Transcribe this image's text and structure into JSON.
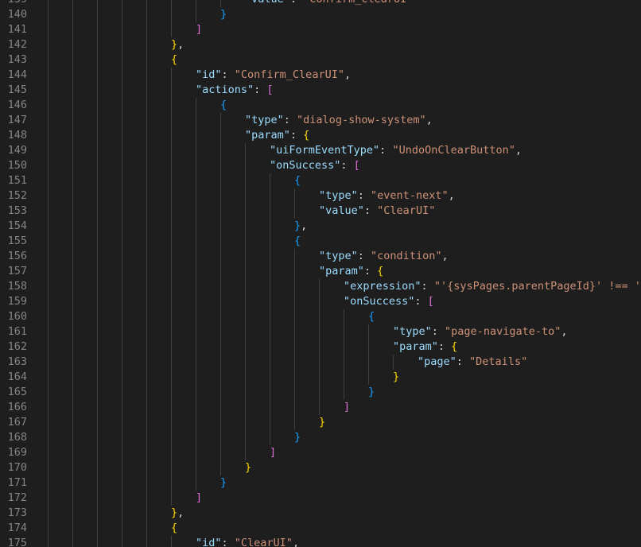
{
  "editor": {
    "language": "json",
    "lines": [
      {
        "n": "139",
        "indent": 8,
        "toks": [
          {
            "t": "\"value\"",
            "c": "k"
          },
          {
            "t": ": ",
            "c": "p"
          },
          {
            "t": "\"Confirm_ClearUI\"",
            "c": "s"
          }
        ]
      },
      {
        "n": "140",
        "indent": 7,
        "toks": [
          {
            "t": "}",
            "c": "b3"
          }
        ]
      },
      {
        "n": "141",
        "indent": 6,
        "toks": [
          {
            "t": "]",
            "c": "b2"
          }
        ]
      },
      {
        "n": "142",
        "indent": 5,
        "toks": [
          {
            "t": "}",
            "c": "b1"
          },
          {
            "t": ",",
            "c": "p"
          }
        ]
      },
      {
        "n": "143",
        "indent": 5,
        "toks": [
          {
            "t": "{",
            "c": "b1"
          }
        ]
      },
      {
        "n": "144",
        "indent": 6,
        "toks": [
          {
            "t": "\"id\"",
            "c": "k"
          },
          {
            "t": ": ",
            "c": "p"
          },
          {
            "t": "\"Confirm_ClearUI\"",
            "c": "s"
          },
          {
            "t": ",",
            "c": "p"
          }
        ]
      },
      {
        "n": "145",
        "indent": 6,
        "toks": [
          {
            "t": "\"actions\"",
            "c": "k"
          },
          {
            "t": ": ",
            "c": "p"
          },
          {
            "t": "[",
            "c": "b2"
          }
        ]
      },
      {
        "n": "146",
        "indent": 7,
        "toks": [
          {
            "t": "{",
            "c": "b3"
          }
        ]
      },
      {
        "n": "147",
        "indent": 8,
        "toks": [
          {
            "t": "\"type\"",
            "c": "k"
          },
          {
            "t": ": ",
            "c": "p"
          },
          {
            "t": "\"dialog-show-system\"",
            "c": "s"
          },
          {
            "t": ",",
            "c": "p"
          }
        ]
      },
      {
        "n": "148",
        "indent": 8,
        "toks": [
          {
            "t": "\"param\"",
            "c": "k"
          },
          {
            "t": ": ",
            "c": "p"
          },
          {
            "t": "{",
            "c": "b1"
          }
        ]
      },
      {
        "n": "149",
        "indent": 9,
        "toks": [
          {
            "t": "\"uiFormEventType\"",
            "c": "k"
          },
          {
            "t": ": ",
            "c": "p"
          },
          {
            "t": "\"UndoOnClearButton\"",
            "c": "s"
          },
          {
            "t": ",",
            "c": "p"
          }
        ]
      },
      {
        "n": "150",
        "indent": 9,
        "toks": [
          {
            "t": "\"onSuccess\"",
            "c": "k"
          },
          {
            "t": ": ",
            "c": "p"
          },
          {
            "t": "[",
            "c": "b2"
          }
        ]
      },
      {
        "n": "151",
        "indent": 10,
        "toks": [
          {
            "t": "{",
            "c": "b3"
          }
        ]
      },
      {
        "n": "152",
        "indent": 11,
        "toks": [
          {
            "t": "\"type\"",
            "c": "k"
          },
          {
            "t": ": ",
            "c": "p"
          },
          {
            "t": "\"event-next\"",
            "c": "s"
          },
          {
            "t": ",",
            "c": "p"
          }
        ]
      },
      {
        "n": "153",
        "indent": 11,
        "toks": [
          {
            "t": "\"value\"",
            "c": "k"
          },
          {
            "t": ": ",
            "c": "p"
          },
          {
            "t": "\"ClearUI\"",
            "c": "s"
          }
        ]
      },
      {
        "n": "154",
        "indent": 10,
        "toks": [
          {
            "t": "}",
            "c": "b3"
          },
          {
            "t": ",",
            "c": "p"
          }
        ]
      },
      {
        "n": "155",
        "indent": 10,
        "toks": [
          {
            "t": "{",
            "c": "b3"
          }
        ]
      },
      {
        "n": "156",
        "indent": 11,
        "toks": [
          {
            "t": "\"type\"",
            "c": "k"
          },
          {
            "t": ": ",
            "c": "p"
          },
          {
            "t": "\"condition\"",
            "c": "s"
          },
          {
            "t": ",",
            "c": "p"
          }
        ]
      },
      {
        "n": "157",
        "indent": 11,
        "toks": [
          {
            "t": "\"param\"",
            "c": "k"
          },
          {
            "t": ": ",
            "c": "p"
          },
          {
            "t": "{",
            "c": "b1"
          }
        ]
      },
      {
        "n": "158",
        "indent": 12,
        "toks": [
          {
            "t": "\"expression\"",
            "c": "k"
          },
          {
            "t": ": ",
            "c": "p"
          },
          {
            "t": "\"'{sysPages.parentPageId}' !== ''\"",
            "c": "s"
          },
          {
            "t": ",",
            "c": "p"
          }
        ]
      },
      {
        "n": "159",
        "indent": 12,
        "toks": [
          {
            "t": "\"onSuccess\"",
            "c": "k"
          },
          {
            "t": ": ",
            "c": "p"
          },
          {
            "t": "[",
            "c": "b2"
          }
        ]
      },
      {
        "n": "160",
        "indent": 13,
        "toks": [
          {
            "t": "{",
            "c": "b3"
          }
        ]
      },
      {
        "n": "161",
        "indent": 14,
        "toks": [
          {
            "t": "\"type\"",
            "c": "k"
          },
          {
            "t": ": ",
            "c": "p"
          },
          {
            "t": "\"page-navigate-to\"",
            "c": "s"
          },
          {
            "t": ",",
            "c": "p"
          }
        ]
      },
      {
        "n": "162",
        "indent": 14,
        "toks": [
          {
            "t": "\"param\"",
            "c": "k"
          },
          {
            "t": ": ",
            "c": "p"
          },
          {
            "t": "{",
            "c": "b1"
          }
        ]
      },
      {
        "n": "163",
        "indent": 15,
        "toks": [
          {
            "t": "\"page\"",
            "c": "k"
          },
          {
            "t": ": ",
            "c": "p"
          },
          {
            "t": "\"Details\"",
            "c": "s"
          }
        ]
      },
      {
        "n": "164",
        "indent": 14,
        "toks": [
          {
            "t": "}",
            "c": "b1"
          }
        ]
      },
      {
        "n": "165",
        "indent": 13,
        "toks": [
          {
            "t": "}",
            "c": "b3"
          }
        ]
      },
      {
        "n": "166",
        "indent": 12,
        "toks": [
          {
            "t": "]",
            "c": "b2"
          }
        ]
      },
      {
        "n": "167",
        "indent": 11,
        "toks": [
          {
            "t": "}",
            "c": "b1"
          }
        ]
      },
      {
        "n": "168",
        "indent": 10,
        "toks": [
          {
            "t": "}",
            "c": "b3"
          }
        ]
      },
      {
        "n": "169",
        "indent": 9,
        "toks": [
          {
            "t": "]",
            "c": "b2"
          }
        ]
      },
      {
        "n": "170",
        "indent": 8,
        "toks": [
          {
            "t": "}",
            "c": "b1"
          }
        ]
      },
      {
        "n": "171",
        "indent": 7,
        "toks": [
          {
            "t": "}",
            "c": "b3"
          }
        ]
      },
      {
        "n": "172",
        "indent": 6,
        "toks": [
          {
            "t": "]",
            "c": "b2"
          }
        ]
      },
      {
        "n": "173",
        "indent": 5,
        "toks": [
          {
            "t": "}",
            "c": "b1"
          },
          {
            "t": ",",
            "c": "p"
          }
        ]
      },
      {
        "n": "174",
        "indent": 5,
        "toks": [
          {
            "t": "{",
            "c": "b1"
          }
        ]
      },
      {
        "n": "175",
        "indent": 6,
        "toks": [
          {
            "t": "\"id\"",
            "c": "k"
          },
          {
            "t": ": ",
            "c": "p"
          },
          {
            "t": "\"ClearUI\"",
            "c": "s"
          },
          {
            "t": ",",
            "c": "p"
          }
        ]
      }
    ]
  }
}
